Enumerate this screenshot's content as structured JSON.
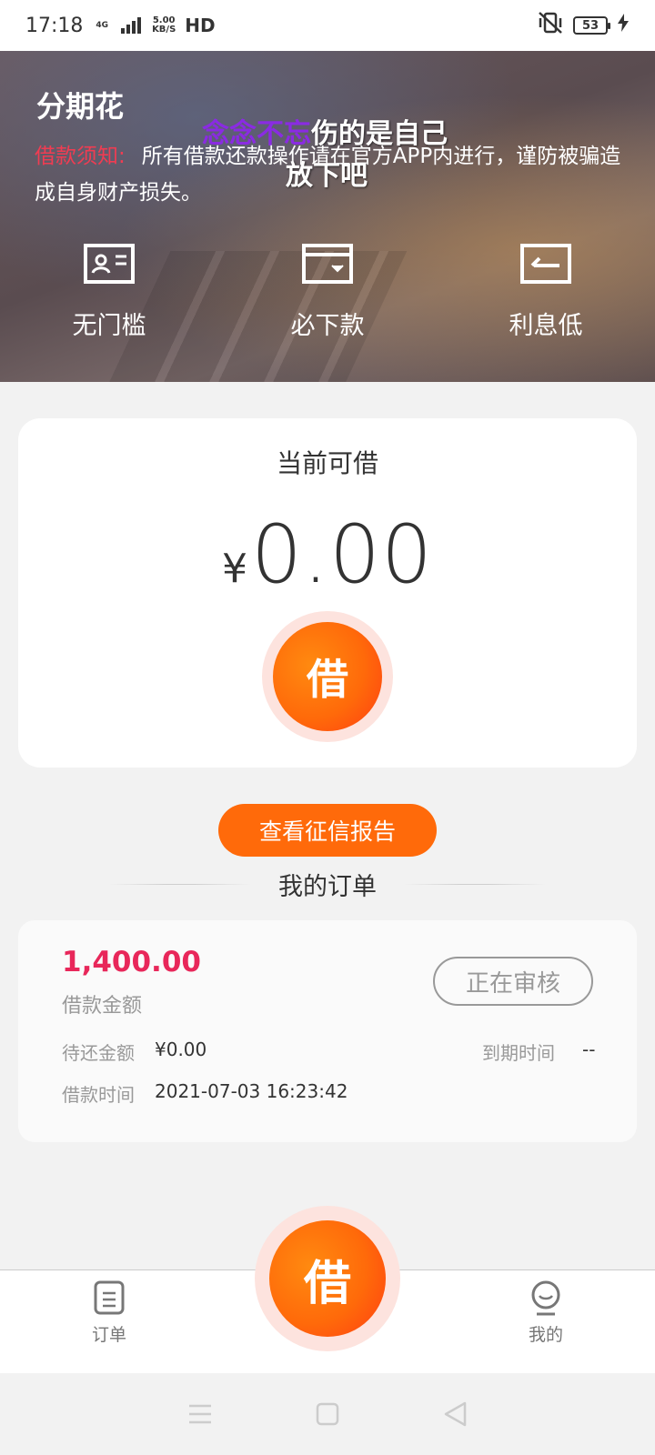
{
  "status_bar": {
    "time": "17:18",
    "network": "4G",
    "speed_value": "5.00",
    "speed_unit": "KB/S",
    "hd": "HD",
    "battery": "53"
  },
  "banner": {
    "title": "分期花",
    "overlay_purple": "念念不忘",
    "overlay_rest": "伤的是自己",
    "overlay_line2": "放下吧",
    "notice_label": "借款须知:",
    "notice_text": "所有借款还款操作请在官方APP内进行，谨防被骗造成自身财产损失。",
    "features": [
      {
        "label": "无门槛",
        "icon": "id-card-icon"
      },
      {
        "label": "必下款",
        "icon": "wallet-icon"
      },
      {
        "label": "利息低",
        "icon": "return-card-icon"
      }
    ]
  },
  "loan_card": {
    "title": "当前可借",
    "currency": "¥",
    "amount": "0.00",
    "borrow_label": "借"
  },
  "credit_button": "查看征信报告",
  "orders_heading": "我的订单",
  "order": {
    "amount": "1,400.00",
    "amount_label": "借款金额",
    "status": "正在审核",
    "pending_label": "待还金额",
    "pending_value": "¥0.00",
    "due_label": "到期时间",
    "due_value": "--",
    "time_label": "借款时间",
    "time_value": "2021-07-03 16:23:42"
  },
  "tab_bar": {
    "orders": "订单",
    "borrow": "借",
    "mine": "我的"
  },
  "colors": {
    "accent": "#ff6a0a",
    "amount_red": "#e8275a",
    "notice_red": "#f03c52"
  }
}
